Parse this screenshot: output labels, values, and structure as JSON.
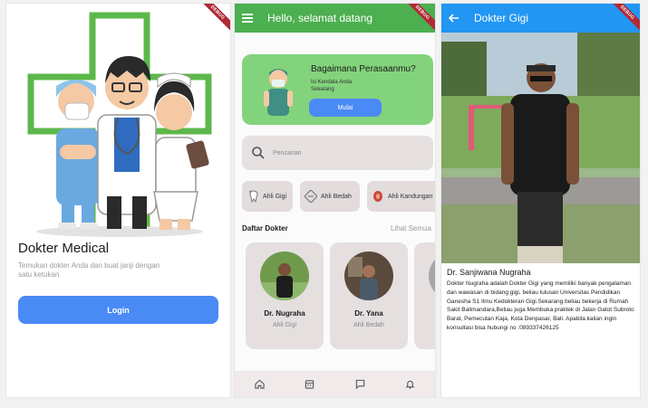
{
  "debug_label": "DEBUG",
  "welcome": {
    "title": "Dokter Medical",
    "subtitle": "Temukan dokter Anda dan buat janji dengan satu ketukan",
    "login_label": "Login"
  },
  "home": {
    "greeting": "Hello, selamat datang",
    "menu_icon": "menu-icon",
    "mood": {
      "question": "Bagaimana Perasaanmu?",
      "description": "Isi Kendala Anda Sekarang",
      "button": "Mulai"
    },
    "search_placeholder": "Pencarian",
    "categories": [
      {
        "label": "Ahli Gigi",
        "icon": "tooth-icon"
      },
      {
        "label": "Ahli Bedah",
        "icon": "surgery-icon"
      },
      {
        "label": "Ahli Kandungan",
        "icon": "womb-icon"
      }
    ],
    "doctor_list_title": "Daftar Dokter",
    "see_all": "Lihat Semua",
    "doctors": [
      {
        "name": "Dr. Nugraha",
        "specialty": "Ahli Gigi"
      },
      {
        "name": "Dr. Yana",
        "specialty": "Ahli Bedah"
      }
    ],
    "nav": [
      "home-icon",
      "calendar-icon",
      "chat-icon",
      "bell-icon"
    ]
  },
  "detail": {
    "title": "Dokter Gigi",
    "name": "Dr. Sanjiwana Nugraha",
    "bio": "Dokter Nugraha adalah Dokter Gigi yang memiliki banyak pengalaman dan wawasan di bidang gigi, beliau lulusan Universitas Pendidikan Ganesha S1 Ilmu Kedokteran Gigi.Sekarang beliau bekerja di Rumah Sakit Balimandara,Beliau juga Membuka praktek di Jalan Gatot Subroto Barat, Pemecutan Kaja, Kota Denpasar, Bali. Apabila kalian ingin konsultasi bisa hubungi no :089337426125"
  },
  "colors": {
    "green": "#4caf50",
    "blue": "#2196f3",
    "button_blue": "#4a8af4",
    "light_green": "#83d37c"
  }
}
